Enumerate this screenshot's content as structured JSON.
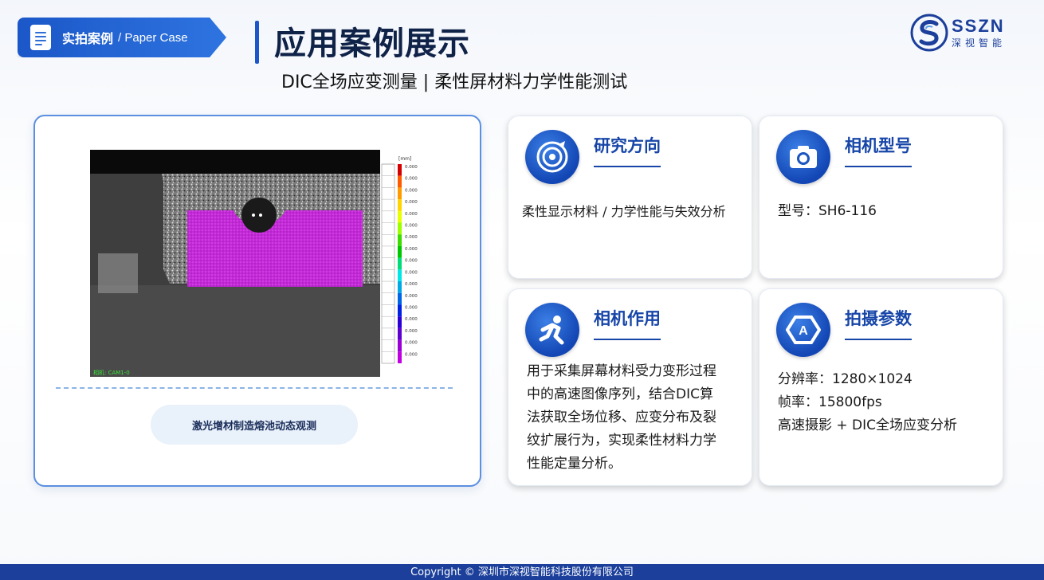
{
  "badge": {
    "title_zh": "实拍案例",
    "title_en": "/ Paper Case"
  },
  "header": {
    "title": "应用案例展示",
    "subtitle": "DIC全场应变测量 | 柔性屏材料力学性能测试"
  },
  "logo": {
    "brand": "SSZN",
    "cn": "深视智能"
  },
  "image_panel": {
    "caption": "激光增材制造熔池动态观测",
    "unit_label": "[mm]",
    "scale_values": [
      "0.000",
      "0.000",
      "0.000",
      "0.000",
      "0.000",
      "0.000",
      "0.000",
      "0.000",
      "0.000",
      "0.000",
      "0.000",
      "0.000",
      "0.000",
      "0.000",
      "0.000",
      "0.000",
      "0.000"
    ],
    "camera_label": "相机: CAM1-0"
  },
  "cards": {
    "research": {
      "title": "研究方向",
      "text": "柔性显示材料 / 力学性能与失效分析"
    },
    "model": {
      "title": "相机型号",
      "text": "型号：SH6-116"
    },
    "role": {
      "title": "相机作用",
      "lines": [
        "用于采集屏幕材料受力变形过程",
        "中的高速图像序列，结合DIC算",
        "法获取全场位移、应变分布及裂",
        "纹扩展行为，实现柔性材料力学",
        "性能定量分析。"
      ]
    },
    "params": {
      "title": "拍摄参数",
      "lines": [
        "分辨率：1280×1024",
        "帧率：15800fps",
        "高速摄影 + DIC全场应变分析"
      ]
    }
  },
  "footer": {
    "copyright": "Copyright © 深圳市深视智能科技股份有限公司"
  },
  "colors": {
    "brand_blue": "#1b57c8",
    "dark_navy": "#0f2248",
    "card_accent": "#1746a8",
    "footer_bg": "#1b3f9a"
  }
}
